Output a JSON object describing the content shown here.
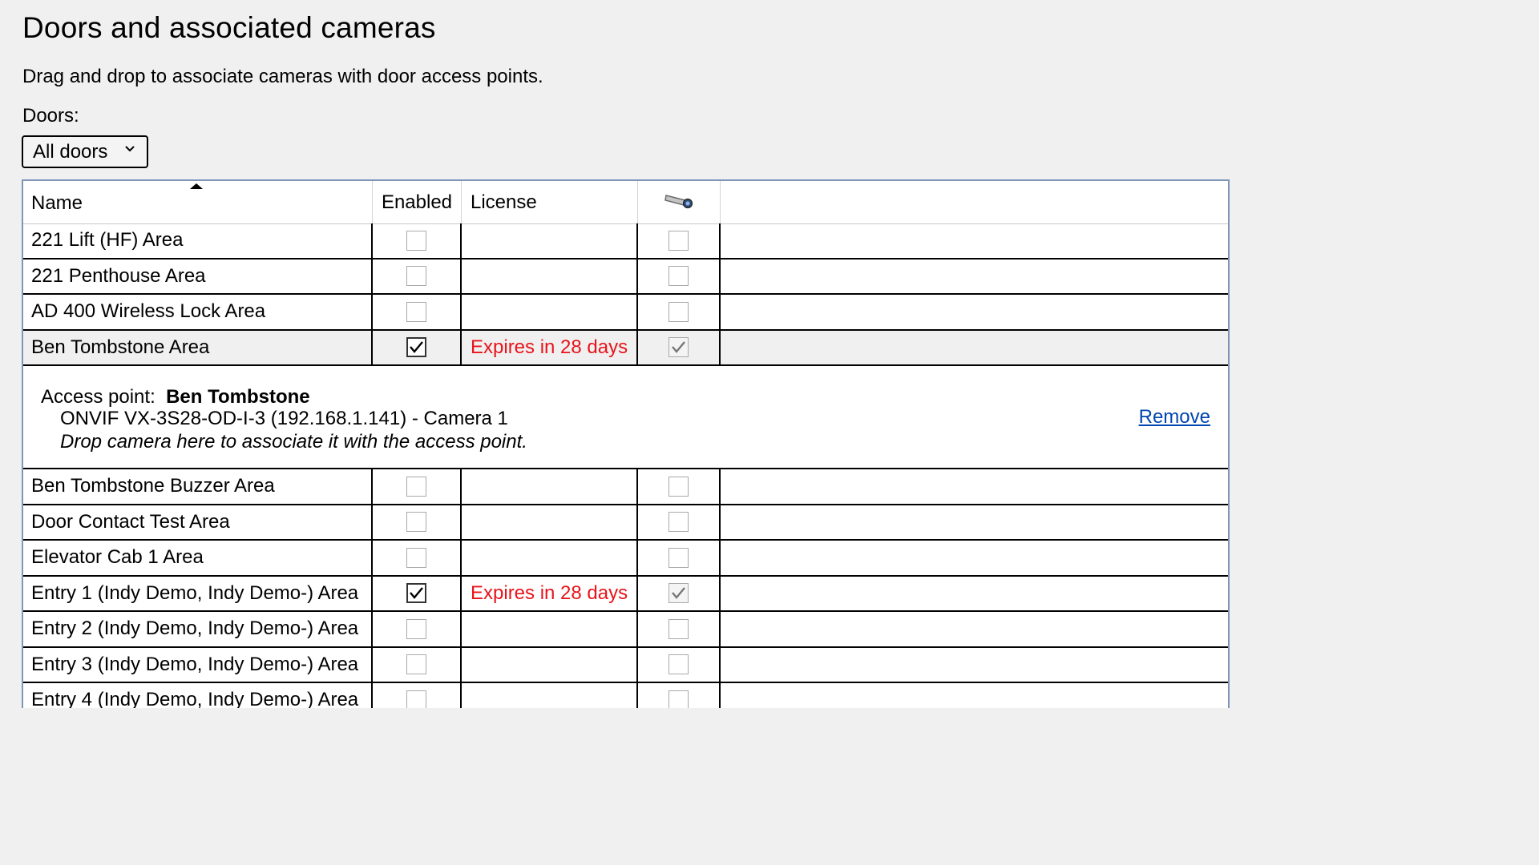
{
  "page": {
    "title": "Doors and associated cameras",
    "description": "Drag and drop to associate cameras with door access points.",
    "doors_label": "Doors:",
    "doors_filter": "All doors"
  },
  "columns": {
    "name": "Name",
    "enabled": "Enabled",
    "license": "License",
    "camera_icon": "camera-icon"
  },
  "rows": [
    {
      "name": "221 Lift (HF) Area",
      "enabled": false,
      "license": "",
      "camera": false
    },
    {
      "name": "221 Penthouse Area",
      "enabled": false,
      "license": "",
      "camera": false
    },
    {
      "name": "AD 400 Wireless Lock Area",
      "enabled": false,
      "license": "",
      "camera": false
    },
    {
      "name": "Ben Tombstone Area",
      "enabled": true,
      "license": "Expires in 28 days",
      "camera": true,
      "selected": true
    },
    {
      "name": "Ben Tombstone Buzzer Area",
      "enabled": false,
      "license": "",
      "camera": false
    },
    {
      "name": "Door Contact Test Area",
      "enabled": false,
      "license": "",
      "camera": false
    },
    {
      "name": "Elevator Cab 1 Area",
      "enabled": false,
      "license": "",
      "camera": false
    },
    {
      "name": "Entry 1 (Indy Demo, Indy Demo-) Area",
      "enabled": true,
      "license": "Expires in 28 days",
      "camera": true
    },
    {
      "name": "Entry 2 (Indy Demo, Indy Demo-) Area",
      "enabled": false,
      "license": "",
      "camera": false
    },
    {
      "name": "Entry 3 (Indy Demo, Indy Demo-) Area",
      "enabled": false,
      "license": "",
      "camera": false
    },
    {
      "name": "Entry 4 (Indy Demo, Indy Demo-) Area",
      "enabled": false,
      "license": "",
      "camera": false
    }
  ],
  "detail": {
    "access_point_label": "Access point:",
    "access_point_name": "Ben Tombstone",
    "camera": "ONVIF VX-3S28-OD-I-3 (192.168.1.141) - Camera 1",
    "drop_hint": "Drop camera here to associate it with the access point.",
    "remove_label": "Remove"
  },
  "colors": {
    "license_warning": "#e8141a",
    "link": "#0046b0",
    "table_border": "#7e95b7"
  }
}
